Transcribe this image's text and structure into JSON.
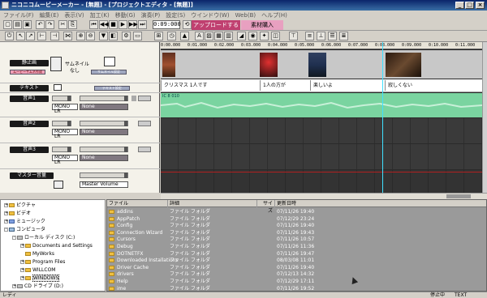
{
  "window": {
    "title": "ニコニコムービーメーカー - [無題] - [プロジェクトエディタ - [無題]]"
  },
  "menu": [
    "ファイル(F)",
    "編集(E)",
    "表示(V)",
    "加工(K)",
    "移動(G)",
    "演奏(P)",
    "設定(S)",
    "ウインドウ(W)",
    "Web(B)",
    "ヘルプ(H)"
  ],
  "toolbar": {
    "timecode": "0:09:000",
    "upload_label": "アップロードする",
    "material_label": "素材購入"
  },
  "tracks": {
    "still": {
      "label": "静止画",
      "button": "ムービーサムネ作成",
      "thumb_text_1": "サムネイル",
      "thumb_text_2": "なし",
      "small_label": "サムネイル設定"
    },
    "text": {
      "label": "テキスト",
      "button": "テキスト設定"
    },
    "audio1": {
      "label": "音声1",
      "channel": "MONO LR",
      "device": "None"
    },
    "audio2": {
      "label": "音声2",
      "channel": "MONO LR",
      "device": "None"
    },
    "audio3": {
      "label": "音声3",
      "channel": "MONO LR",
      "device": "None"
    },
    "master": {
      "label": "マスター音量",
      "device": "Master Volume"
    }
  },
  "timeline": {
    "ticks": [
      "0:00.000",
      "0:01.000",
      "0:02.000",
      "0:03.000",
      "0:04.000",
      "0:05.000",
      "0:06.000",
      "0:07.000",
      "0:08.000",
      "0:09.000",
      "0:10.000",
      "0:11.000",
      "0:12.000"
    ],
    "text_clips": [
      "クリスマス 1人です",
      "1人の方が",
      "楽しいよ",
      "寂しくない"
    ],
    "audio_clip_label": "IC 8 010"
  },
  "folders": [
    {
      "name": "ピクチャ",
      "icon": "folder-icon",
      "indent": 0,
      "expander": "+"
    },
    {
      "name": "ビデオ",
      "icon": "folder-icon",
      "indent": 0,
      "expander": "+"
    },
    {
      "name": "ミュージック",
      "icon": "music-folder-icon",
      "indent": 0,
      "expander": "+"
    },
    {
      "name": "コンピュータ",
      "icon": "computer-icon",
      "indent": 0,
      "expander": "-"
    },
    {
      "name": "ローカル ディスク (C:)",
      "icon": "drive-icon",
      "indent": 1,
      "expander": "-"
    },
    {
      "name": "Documents and Settings",
      "icon": "folder-icon",
      "indent": 2,
      "expander": "+"
    },
    {
      "name": "MyWorks",
      "icon": "folder-icon",
      "indent": 2,
      "expander": ""
    },
    {
      "name": "Program Files",
      "icon": "folder-icon",
      "indent": 2,
      "expander": "+"
    },
    {
      "name": "WILLCOM",
      "icon": "folder-icon",
      "indent": 2,
      "expander": "+"
    },
    {
      "name": "WINDOWS",
      "icon": "folder-icon",
      "indent": 2,
      "expander": "+"
    },
    {
      "name": "CD ドライブ (D:)",
      "icon": "drive-icon",
      "indent": 1,
      "expander": "+"
    }
  ],
  "filelist": {
    "headers": [
      "ファイル",
      "詳細",
      "サイズ",
      "更新日時"
    ],
    "rows": [
      {
        "name": "addins",
        "type": "ファイル フォルダ",
        "size": "",
        "date": "07/11/26 19:40"
      },
      {
        "name": "AppPatch",
        "type": "ファイル フォルダ",
        "size": "",
        "date": "07/12/29 23:24"
      },
      {
        "name": "Config",
        "type": "ファイル フォルダ",
        "size": "",
        "date": "07/11/26 19:40"
      },
      {
        "name": "Connection Wizard",
        "type": "ファイル フォルダ",
        "size": "",
        "date": "07/11/26 19:43"
      },
      {
        "name": "Cursors",
        "type": "ファイル フォルダ",
        "size": "",
        "date": "07/11/26 10:57"
      },
      {
        "name": "Debug",
        "type": "ファイル フォルダ",
        "size": "",
        "date": "07/11/26 11:36"
      },
      {
        "name": "DOTNETFX",
        "type": "ファイル フォルダ",
        "size": "",
        "date": "07/11/26 19:47"
      },
      {
        "name": "Downloaded Installations",
        "type": "ファイル フォルダ",
        "size": "",
        "date": "08/03/08 11:01"
      },
      {
        "name": "Driver Cache",
        "type": "ファイル フォルダ",
        "size": "",
        "date": "07/11/26 19:40"
      },
      {
        "name": "drivers",
        "type": "ファイル フォルダ",
        "size": "",
        "date": "07/12/13 14:32"
      },
      {
        "name": "Help",
        "type": "ファイル フォルダ",
        "size": "",
        "date": "07/12/29 17:11"
      },
      {
        "name": "ime",
        "type": "ファイル フォルダ",
        "size": "",
        "date": "07/11/26 19:52"
      }
    ]
  },
  "status": {
    "left": "レディ",
    "mode": "停止中",
    "right": "TEXT"
  },
  "colors": {
    "title_bar": "#0a246a",
    "audio_wave": "#7ad4a0",
    "playhead": "#40e0ff",
    "upload_tab": "#c04070"
  }
}
